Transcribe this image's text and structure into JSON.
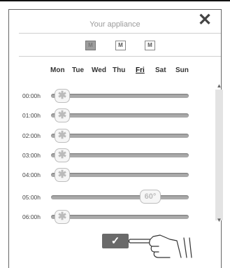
{
  "header": {
    "title": "Your appliance",
    "close_icon": "close-icon"
  },
  "modes": [
    {
      "label": "M",
      "icon": "mode-icon",
      "active": true
    },
    {
      "label": "M",
      "icon": "mode-icon",
      "active": false
    },
    {
      "label": "M",
      "icon": "mode-icon",
      "active": false
    }
  ],
  "days": [
    {
      "label": "Mon",
      "selected": false
    },
    {
      "label": "Tue",
      "selected": false
    },
    {
      "label": "Wed",
      "selected": false
    },
    {
      "label": "Thu",
      "selected": false
    },
    {
      "label": "Fri",
      "selected": true
    },
    {
      "label": "Sat",
      "selected": false
    },
    {
      "label": "Sun",
      "selected": false
    }
  ],
  "schedule": [
    {
      "time": "00:00h",
      "handle": "✱",
      "level": 0.0
    },
    {
      "time": "01:00h",
      "handle": "✱",
      "level": 0.0
    },
    {
      "time": "02:00h",
      "handle": "✱",
      "level": 0.0
    },
    {
      "time": "03:00h",
      "handle": "✱",
      "level": 0.0
    },
    {
      "time": "04:00h",
      "handle": "✱",
      "level": 0.0
    },
    {
      "time": "05:00h",
      "handle": "60°",
      "level": 0.67
    },
    {
      "time": "06:00h",
      "handle": "✱",
      "level": 0.0
    }
  ],
  "confirm": {
    "label": "✓",
    "icon": "checkmark-icon"
  },
  "colors": {
    "track": "#a9a9a9",
    "confirm": "#6a6a6a",
    "active_mode": "#9e9e9e"
  }
}
